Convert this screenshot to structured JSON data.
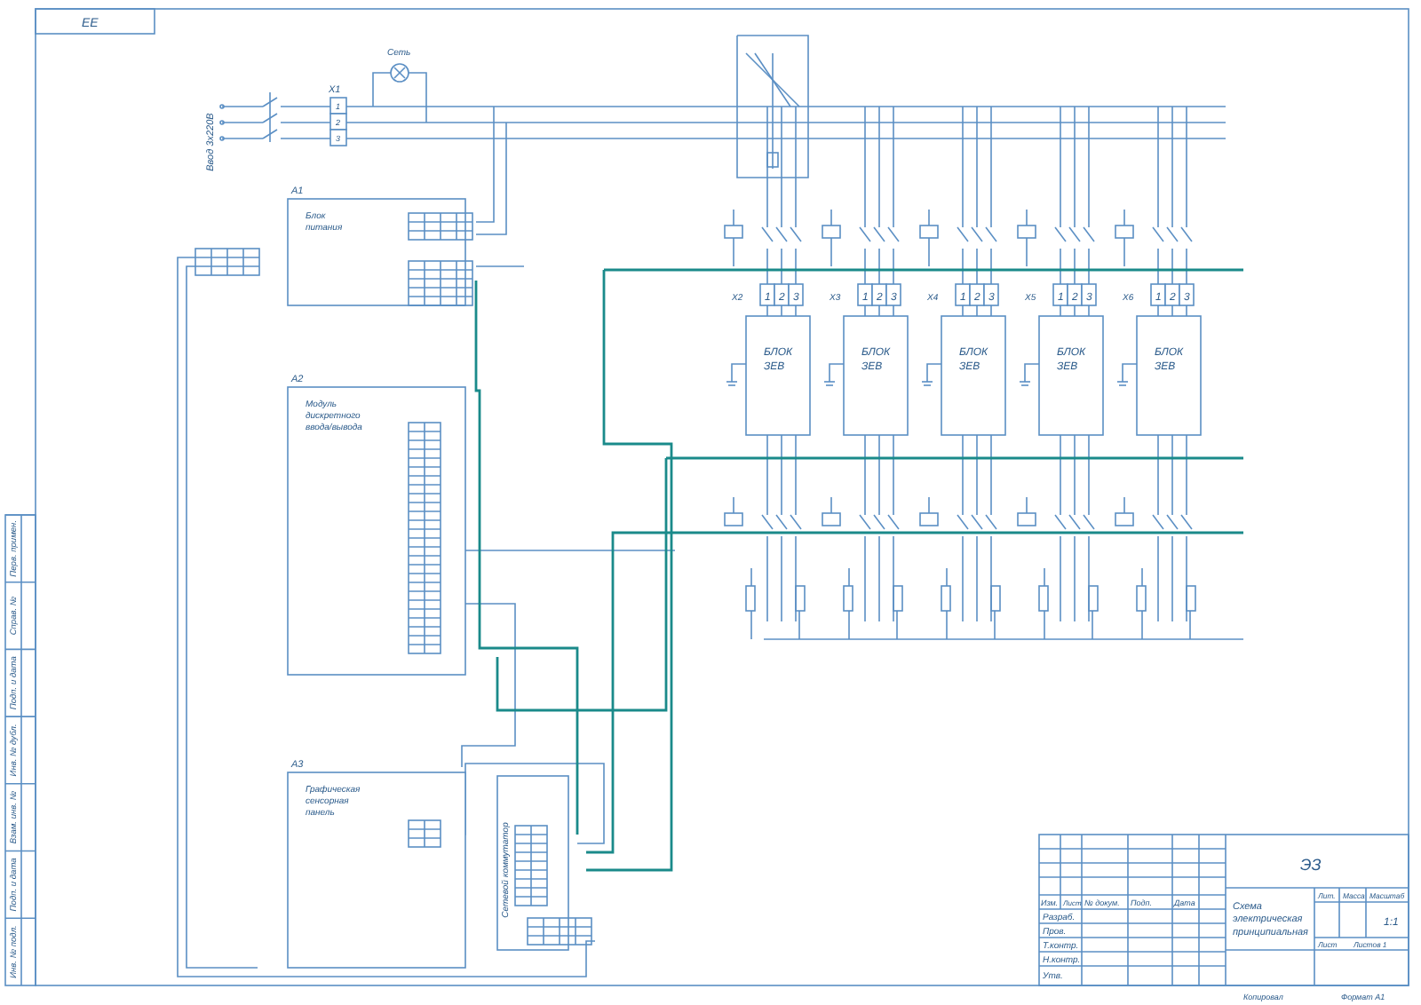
{
  "stamp": "ЕЕ",
  "input": {
    "label": "Ввод 3х220В",
    "terminal": "X1",
    "pins": [
      "1",
      "2",
      "3"
    ],
    "lamp": "Сеть"
  },
  "units": [
    {
      "ref": "A1",
      "title": [
        "Блок",
        "питания"
      ]
    },
    {
      "ref": "A2",
      "title": [
        "Модуль",
        "дискретного",
        "ввода/вывода"
      ]
    },
    {
      "ref": "A3",
      "title": [
        "Графическая",
        "сенсорная",
        "панель"
      ]
    }
  ],
  "switch": {
    "title": "Сетевой коммутатор"
  },
  "drives": [
    {
      "terminal": "X2",
      "pins": [
        "1",
        "2",
        "3"
      ],
      "title": [
        "БЛОК",
        "ЗЕВ"
      ]
    },
    {
      "terminal": "X3",
      "pins": [
        "1",
        "2",
        "3"
      ],
      "title": [
        "БЛОК",
        "ЗЕВ"
      ]
    },
    {
      "terminal": "X4",
      "pins": [
        "1",
        "2",
        "3"
      ],
      "title": [
        "БЛОК",
        "ЗЕВ"
      ]
    },
    {
      "terminal": "X5",
      "pins": [
        "1",
        "2",
        "3"
      ],
      "title": [
        "БЛОК",
        "ЗЕВ"
      ]
    },
    {
      "terminal": "X6",
      "pins": [
        "1",
        "2",
        "3"
      ],
      "title": [
        "БЛОК",
        "ЗЕВ"
      ]
    }
  ],
  "title_block": {
    "code": "ЭЗ",
    "name": "Схема электрическая принципиальная",
    "columns": [
      "Изм.",
      "Лист",
      "№ докум.",
      "Подп.",
      "Дата"
    ],
    "roles": [
      "Разраб.",
      "Пров.",
      "Т.контр.",
      "Н.контр.",
      "Утв."
    ],
    "headers": [
      "Лит.",
      "Масса",
      "Масштаб"
    ],
    "scale": "1:1",
    "sheet": "Лист",
    "sheets": "Листов 1"
  },
  "margin_labels": [
    "Перв. примен.",
    "Справ. №",
    "Подп. и дата",
    "Инв. № дубл.",
    "Взам. инв. №",
    "Подп. и дата",
    "Инв. № подл."
  ],
  "footer": {
    "copied": "Копировал",
    "format": "Формат А1"
  }
}
